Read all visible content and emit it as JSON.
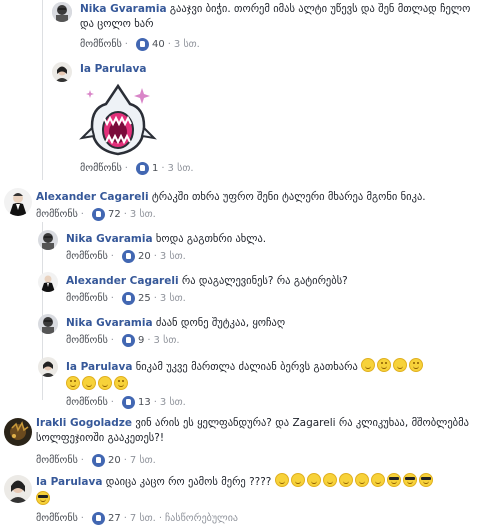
{
  "comments": [
    {
      "id": "c1",
      "author": "Nika Gvaramia",
      "text": "გააჯვი ბიჭი. თორემ იმას ალტი უწევს და შენ მთლად ჩელო და ცოლო ხარ",
      "like_label": "მომწონს",
      "likes": "40",
      "time": "3 სთ."
    },
    {
      "id": "c2",
      "author": "Ia Parulava",
      "text": "",
      "sticker": "shark-sticker",
      "like_label": "მომწონს",
      "likes": "1",
      "time": "3 სთ."
    },
    {
      "id": "c3",
      "author": "Alexander Cagareli",
      "text": "ტრაკში თხრა უფრო შენი ტალერი მხარეა მგონი ნიკა.",
      "like_label": "მომწონს",
      "likes": "72",
      "time": "3 სთ."
    },
    {
      "id": "c4",
      "author": "Nika Gvaramia",
      "text": "ხოდა გაგთხრი ახლა.",
      "like_label": "მომწონს",
      "likes": "20",
      "time": "3 სთ."
    },
    {
      "id": "c5",
      "author": "Alexander Cagareli",
      "text": "რა დაგალევინეს? რა გატირებს?",
      "like_label": "მომწონს",
      "likes": "25",
      "time": "3 სთ."
    },
    {
      "id": "c6",
      "author": "Nika Gvaramia",
      "text": "ძაან დონე შუტკაა, ყოჩაღ",
      "like_label": "მომწონს",
      "likes": "9",
      "time": "3 სთ."
    },
    {
      "id": "c7",
      "author": "Ia Parulava",
      "text": "ნიკამ უკვე მართლა ძალიან ბერვს გათხარა",
      "like_label": "მომწონს",
      "likes": "13",
      "time": "3 სთ."
    },
    {
      "id": "c8",
      "author": "Irakli Gogoladze",
      "text": "ვინ არის ეს ყელფანდურა? და Zagareli რა კლიკუხაა, მშობლებმა სოლფეჯიოში გააკეთეს?!",
      "like_label": "მომწონს",
      "likes": "20",
      "time": "7 სთ."
    },
    {
      "id": "c9",
      "author": "Ia Parulava",
      "text": "დაიცა კაცო რო ეამოს მერე ????",
      "like_label": "მომწონს",
      "likes": "27",
      "time": "7 სთ.",
      "extra": "ჩასწორებულია"
    }
  ]
}
